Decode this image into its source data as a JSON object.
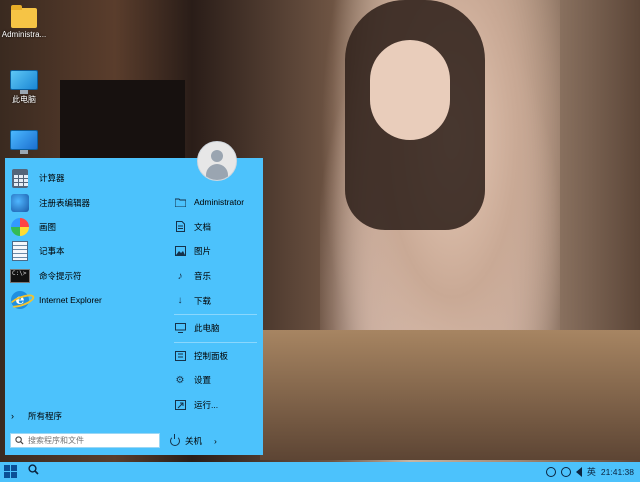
{
  "desktop": {
    "icons": [
      {
        "label": "Administra...",
        "icon": "folder-icon"
      },
      {
        "label": "此电脑",
        "icon": "computer-icon"
      },
      {
        "label": "",
        "icon": "network-icon"
      }
    ]
  },
  "start_menu": {
    "apps": [
      {
        "label": "计算器",
        "icon": "calculator-icon"
      },
      {
        "label": "注册表编辑器",
        "icon": "registry-editor-icon"
      },
      {
        "label": "画图",
        "icon": "paint-icon"
      },
      {
        "label": "记事本",
        "icon": "notepad-icon"
      },
      {
        "label": "命令提示符",
        "icon": "cmd-icon"
      },
      {
        "label": "Internet Explorer",
        "icon": "ie-icon"
      }
    ],
    "all_programs": "所有程序",
    "search_placeholder": "搜索程序和文件",
    "user": "Administrator",
    "right_items": [
      {
        "label": "文档",
        "icon": "document-icon"
      },
      {
        "label": "图片",
        "icon": "picture-icon"
      },
      {
        "label": "音乐",
        "icon": "music-icon"
      },
      {
        "label": "下载",
        "icon": "download-icon"
      },
      {
        "label": "此电脑",
        "icon": "computer-icon"
      },
      {
        "label": "控制面板",
        "icon": "control-panel-icon"
      },
      {
        "label": "设置",
        "icon": "gear-icon"
      },
      {
        "label": "运行...",
        "icon": "run-icon"
      }
    ],
    "shutdown": "关机",
    "shutdown_arrow": "›",
    "all_programs_arrow": "›"
  },
  "taskbar": {
    "ime": "英",
    "clock": "21:41:38"
  },
  "colors": {
    "menu_bg": "#4cc2fc",
    "taskbar_bg": "#4cc2fc"
  }
}
